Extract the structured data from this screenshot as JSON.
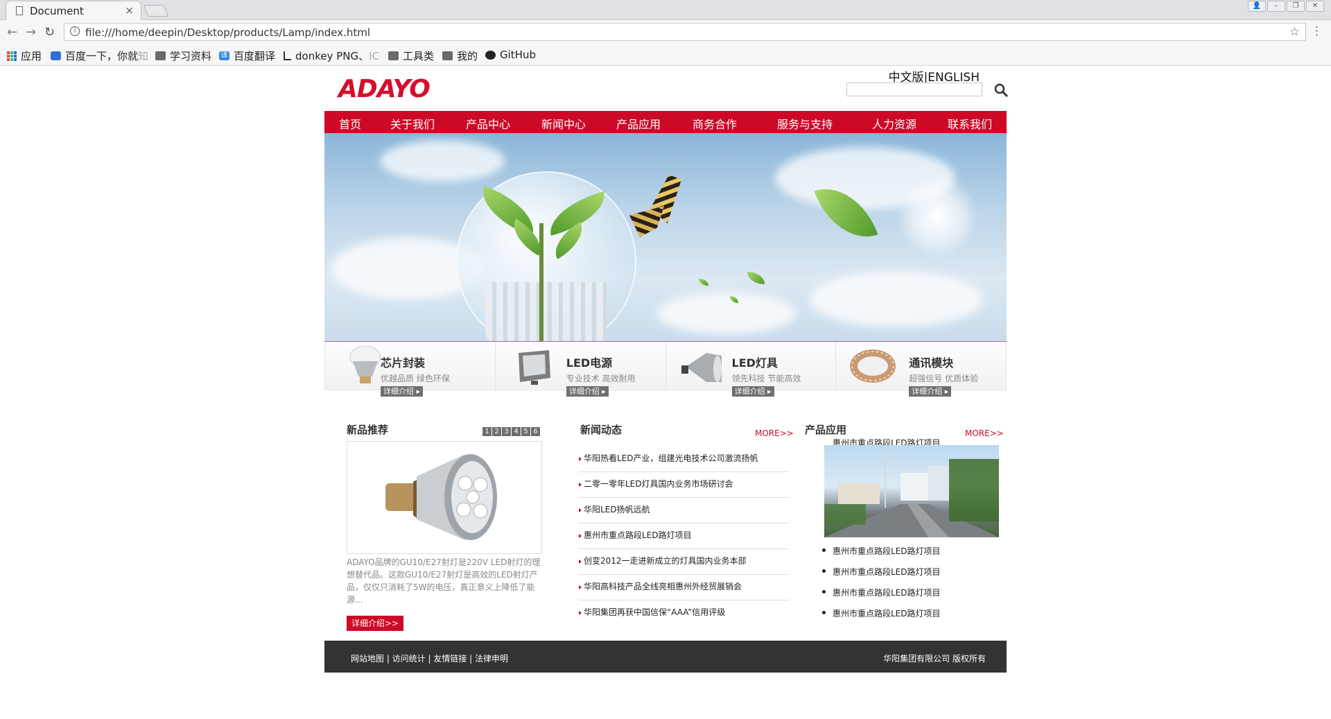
{
  "browser": {
    "tab_title": "Document",
    "tab_close": "×",
    "url": "file:///home/deepin/Desktop/products/Lamp/index.html",
    "back_icon": "←",
    "forward_icon": "→",
    "reload_icon": "↻",
    "info_icon": "i",
    "star_icon": "☆",
    "menu_icon": "⋮",
    "window_buttons": [
      "👤",
      "–",
      "❐",
      "✕"
    ],
    "bookmarks": [
      {
        "label": "应用",
        "icon": "apps-icon"
      },
      {
        "label": "百度一下，你就",
        "fade": "知",
        "icon": "baidu-icon"
      },
      {
        "label": "学习资料",
        "icon": "folder-icon"
      },
      {
        "label": "百度翻译",
        "icon": "fanyi-icon"
      },
      {
        "label": "donkey PNG、",
        "fade": "IC",
        "icon": "donkey-icon"
      },
      {
        "label": "工具类",
        "icon": "folder-icon"
      },
      {
        "label": "我的",
        "icon": "folder-icon"
      },
      {
        "label": "GitHub",
        "icon": "github-icon"
      }
    ]
  },
  "site": {
    "logo": "ADAYO",
    "lang_cn": "中文版",
    "lang_sep": "|",
    "lang_en": "ENGLISH",
    "nav": [
      "首页",
      "关于我们",
      "产品中心",
      "新闻中心",
      "产品应用",
      "商务合作",
      "服务与支持",
      "人力资源",
      "联系我们"
    ],
    "categories": [
      {
        "name": "芯片封装",
        "desc": "优越品质 绿色环保",
        "more": "详细介绍"
      },
      {
        "name": "LED电源",
        "desc": "专业技术 高效耐用",
        "more": "详细介绍"
      },
      {
        "name": "LED灯具",
        "desc": "领先科技 节能高效",
        "more": "详细介绍"
      },
      {
        "name": "通讯模块",
        "desc": "超强信号 优质体验",
        "more": "详细介绍"
      }
    ],
    "new_products": {
      "title": "新品推荐",
      "pages": [
        "1",
        "2",
        "3",
        "4",
        "5",
        "6"
      ],
      "text": "ADAYO品牌的GU10/E27射灯是220V LED射灯的理想替代品。这款GU10/E27射灯是高效的LED射灯产品，仅仅只消耗了5W的电压，真正意义上降低了能源...",
      "button": "详细介绍>>"
    },
    "news": {
      "title": "新闻动态",
      "more": "MORE>>",
      "items": [
        "华阳热看LED产业，组建光电技术公司激流扬帆",
        "二零一零年LED灯具国内业务市场研讨会",
        "华阳LED扬帆远航",
        "惠州市重点路段LED路灯项目",
        "创变2012一走进新成立的灯具国内业务本部",
        "华阳高科技产品全线亮相惠州外经贸展销会",
        "华阳集团再获中国信保“AAA”信用评级"
      ]
    },
    "applications": {
      "title": "产品应用",
      "more": "MORE>>",
      "caption": "惠州市重点路段LED路灯项目",
      "items": [
        "惠州市重点路段LED路灯项目",
        "惠州市重点路段LED路灯项目",
        "惠州市重点路段LED路灯项目",
        "惠州市重点路段LED路灯项目"
      ]
    },
    "footer": {
      "links": "网站地图 | 访问统计 | 友情链接 | 法律申明",
      "copyright": "华阳集团有限公司 版权所有"
    },
    "colors": {
      "brand_red": "#cd0a26",
      "footer_bg": "#333333"
    }
  }
}
